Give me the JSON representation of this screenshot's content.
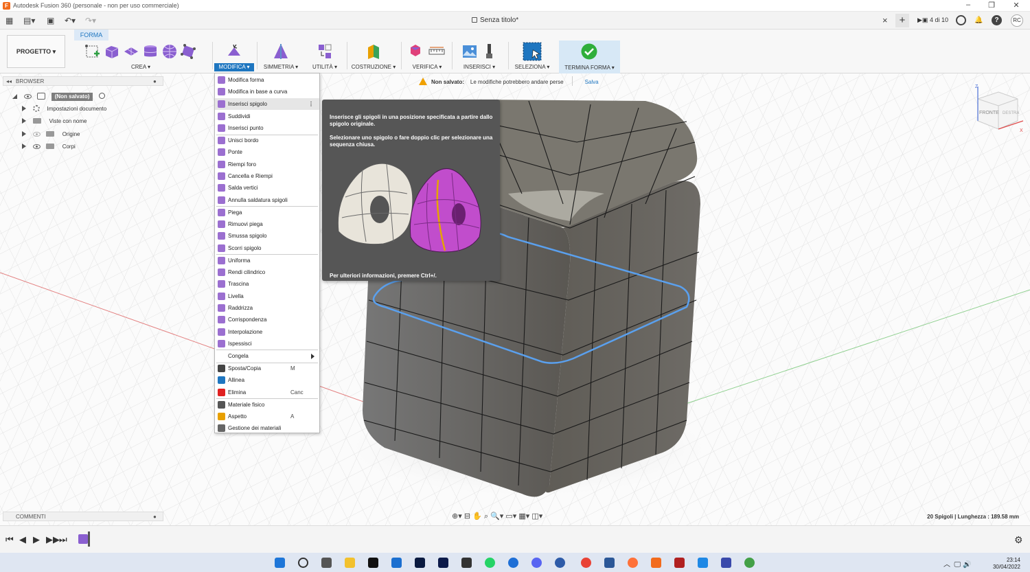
{
  "window": {
    "title": "Autodesk Fusion 360 (personale - non per uso commerciale)"
  },
  "tabbar": {
    "doc_title": "Senza titolo*",
    "version": "4 di 10",
    "user_initials": "RC",
    "close_glyph": "×",
    "plus_glyph": "+"
  },
  "ribbon": {
    "project_label": "PROGETTO ▾",
    "active_tab": "FORMA",
    "groups": {
      "crea": "CREA ▾",
      "modifica": "MODIFICA ▾",
      "simmetria": "SIMMETRIA ▾",
      "utilita": "UTILITÀ ▾",
      "costruzione": "COSTRUZIONE ▾",
      "verifica": "VERIFICA ▾",
      "inserisci": "INSERISCI ▾",
      "seleziona": "SELEZIONA ▾",
      "termina": "TERMINA FORMA ▾"
    },
    "accent": "#1e76c0"
  },
  "browser": {
    "header": "BROWSER",
    "root": "(Non salvato)",
    "items": [
      "Impostazioni documento",
      "Viste con nome",
      "Origine",
      "Corpi"
    ]
  },
  "notice": {
    "label": "Non salvato:",
    "message": "Le modifiche potrebbero andare perse",
    "action": "Salva"
  },
  "viewcube": {
    "front": "FRONTE",
    "right": "DESTRA",
    "z": "Z",
    "x": "X"
  },
  "menu": {
    "items": [
      {
        "label": "Modifica forma",
        "icon": "edit-form-icon",
        "color": "#9b6fd0"
      },
      {
        "label": "Modifica in base a curva",
        "icon": "edit-curve-icon",
        "color": "#9b6fd0"
      },
      {
        "label": "Inserisci spigolo",
        "icon": "insert-edge-icon",
        "color": "#9b6fd0",
        "more": "⋮"
      },
      {
        "label": "Suddividi",
        "icon": "subdivide-icon",
        "color": "#9b6fd0"
      },
      {
        "label": "Inserisci punto",
        "icon": "insert-point-icon",
        "color": "#9b6fd0"
      },
      {
        "label": "Unisci bordo",
        "icon": "merge-edge-icon",
        "color": "#9b6fd0"
      },
      {
        "label": "Ponte",
        "icon": "bridge-icon",
        "color": "#9b6fd0"
      },
      {
        "label": "Riempi foro",
        "icon": "fill-hole-icon",
        "color": "#9b6fd0"
      },
      {
        "label": "Cancella e Riempi",
        "icon": "erase-fill-icon",
        "color": "#9b6fd0"
      },
      {
        "label": "Salda vertici",
        "icon": "weld-vertices-icon",
        "color": "#9b6fd0"
      },
      {
        "label": "Annulla saldatura spigoli",
        "icon": "unweld-edges-icon",
        "color": "#9b6fd0"
      },
      {
        "label": "Piega",
        "icon": "crease-icon",
        "color": "#9b6fd0"
      },
      {
        "label": "Rimuovi piega",
        "icon": "uncrease-icon",
        "color": "#9b6fd0"
      },
      {
        "label": "Smussa spigolo",
        "icon": "bevel-edge-icon",
        "color": "#9b6fd0"
      },
      {
        "label": "Scorri spigolo",
        "icon": "slide-edge-icon",
        "color": "#9b6fd0"
      },
      {
        "label": "Uniforma",
        "icon": "smooth-icon",
        "color": "#9b6fd0"
      },
      {
        "label": "Rendi cilindrico",
        "icon": "cylindrify-icon",
        "color": "#9b6fd0"
      },
      {
        "label": "Trascina",
        "icon": "pull-icon",
        "color": "#9b6fd0"
      },
      {
        "label": "Livella",
        "icon": "flatten-icon",
        "color": "#9b6fd0"
      },
      {
        "label": "Raddrizza",
        "icon": "straighten-icon",
        "color": "#9b6fd0"
      },
      {
        "label": "Corrispondenza",
        "icon": "match-icon",
        "color": "#9b6fd0"
      },
      {
        "label": "Interpolazione",
        "icon": "interpolate-icon",
        "color": "#9b6fd0"
      },
      {
        "label": "Ispessisci",
        "icon": "thicken-icon",
        "color": "#9b6fd0"
      },
      {
        "label": "Congela",
        "icon": "",
        "color": "",
        "submenu": true
      },
      {
        "label": "Sposta/Copia",
        "icon": "move-icon",
        "color": "#444444",
        "shortcut": "M"
      },
      {
        "label": "Allinea",
        "icon": "align-icon",
        "color": "#1e76c0"
      },
      {
        "label": "Elimina",
        "icon": "delete-icon",
        "color": "#e02020",
        "shortcut": "Canc"
      },
      {
        "label": "Materiale fisico",
        "icon": "physical-material-icon",
        "color": "#555555"
      },
      {
        "label": "Aspetto",
        "icon": "appearance-icon",
        "color": "#e8a000",
        "shortcut": "A"
      },
      {
        "label": "Gestione dei materiali",
        "icon": "manage-materials-icon",
        "color": "#666666"
      }
    ]
  },
  "tooltip": {
    "line1": "Inserisce gli spigoli in una posizione specificata a partire dallo spigolo originale.",
    "line2": "Selezionare uno spigolo o fare doppio clic per selezionare una sequenza chiusa.",
    "footer": "Per ulteriori informazioni, premere Ctrl+/."
  },
  "bottom": {
    "comments": "COMMENTI",
    "status": "20 Spigoli | Lunghezza : 189.58 mm"
  },
  "taskbar": {
    "time": "23:14",
    "date": "30/04/2022"
  }
}
